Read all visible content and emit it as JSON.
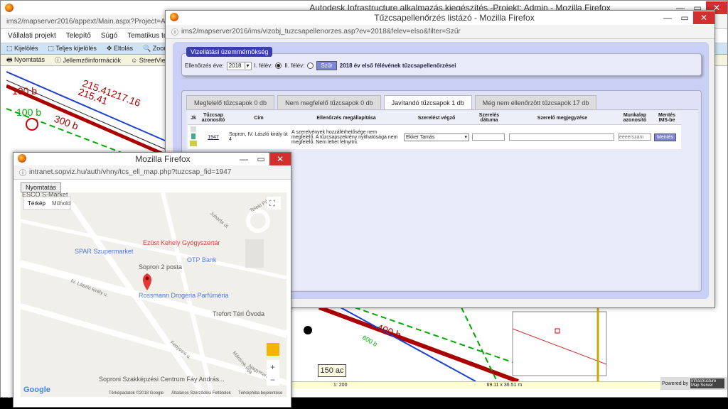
{
  "main_window": {
    "title": "Autodesk Infrastructure alkalmazás kiegészítés -Projekt: Admin - Mozilla Firefox",
    "url": "ims2/mapserver2016/appext/Main.aspx?Project=Admin",
    "menu": [
      "Vállalati projekt",
      "Telepítő",
      "Súgó",
      "Tematikus térképek"
    ],
    "toolbar": [
      "Kijelölés",
      "Teljes kijelölés",
      "Eltolás",
      "Zoom"
    ],
    "toolbar2": [
      "Nyomtatás",
      "Jellemzőinformációk",
      "StreetView"
    ],
    "map_labels": [
      "100 b",
      "215.41217.16",
      "215.41",
      "300 b",
      "100 b",
      "400 b",
      "600 b",
      "400 b",
      "200 b",
      "100 b"
    ],
    "scale_label": "150 ac",
    "scale_text": "1: 200",
    "extent": "69.11 x 36.51 m",
    "powered_by": "Powered by",
    "brand": "Infrastructure Map Server",
    "taskbar_text": "Tru"
  },
  "list_window": {
    "title": "Tűzcsapellenőrzés listázó - Mozilla Firefox",
    "url": "ims2/mapserver2016/ims/vizobj_tuzcsapellenorzes.asp?ev=2018&felev=elso&filter=Szűr",
    "panel_title": "Vizellátási üzemmérnökség",
    "year_label": "Ellenőrzés éve:",
    "year_value": "2018",
    "half1_label": "I. félév:",
    "half2_label": "II. félév:",
    "filter_button": "Szűr",
    "filter_caption": "2018 év első félévének tűzcsapellenőrzései",
    "tabs": [
      "Megfelelő tűzcsapok 0 db",
      "Nem megfelelő tűzcsapok 0 db",
      "Javítandó tűzcsapok 1 db",
      "Még nem ellenőrzött tűzcsapok 17 db"
    ],
    "columns": [
      "Jk",
      "Tűzcsap azonosító",
      "Cím",
      "Ellenőrzés megállapítása",
      "Szerelést végző",
      "Szerelés dátuma",
      "Szerelő megjegyzése",
      "Munkalap azonosító",
      "Mentés IMS-be"
    ],
    "row": {
      "id": "1947",
      "address": "Sopron, IV. László király út 4",
      "finding": "A szerelvények hozzáférhetősége nem megfelelő. A tűzcsapszekrény nyithatósága nem megfelelő. Nem lehet felnyitni.",
      "fitter": "Ekker Tamás",
      "date": "",
      "note": "",
      "worksheet_placeholder": "éééé/szám",
      "save": "Mentés"
    }
  },
  "map_window": {
    "title": "Mozilla Firefox",
    "url": "intranet.sopviz.hu/auth/vhny/tcs_ell_map.php?tuzcsap_fid=1947",
    "print_button": "Nyomtatás",
    "map_type_buttons": [
      "Térkép",
      "Műhold"
    ],
    "places": [
      "ESCO S-Market",
      "Ezüst Kehely Gyógyszertár",
      "SPAR Szupermarket",
      "Sopron 2 posta",
      "OTP Bank",
      "Rossmann Drogéria Parfüméria",
      "Trefort Téri Óvoda",
      "Soproni Szakképzési Centrum Fáy András..."
    ],
    "streets": [
      "Juharfa út",
      "Teleki Pál út",
      "IV. László király u.",
      "Fenyvesi u.",
      "Mártírok útja",
      "Nagymart"
    ],
    "footer": [
      "Térképadatok ©2018 Google",
      "Általános Szerződési Feltételek",
      "Térképhiba bejelentése"
    ],
    "logo": "Google",
    "zoom_in": "+",
    "zoom_out": "−"
  }
}
